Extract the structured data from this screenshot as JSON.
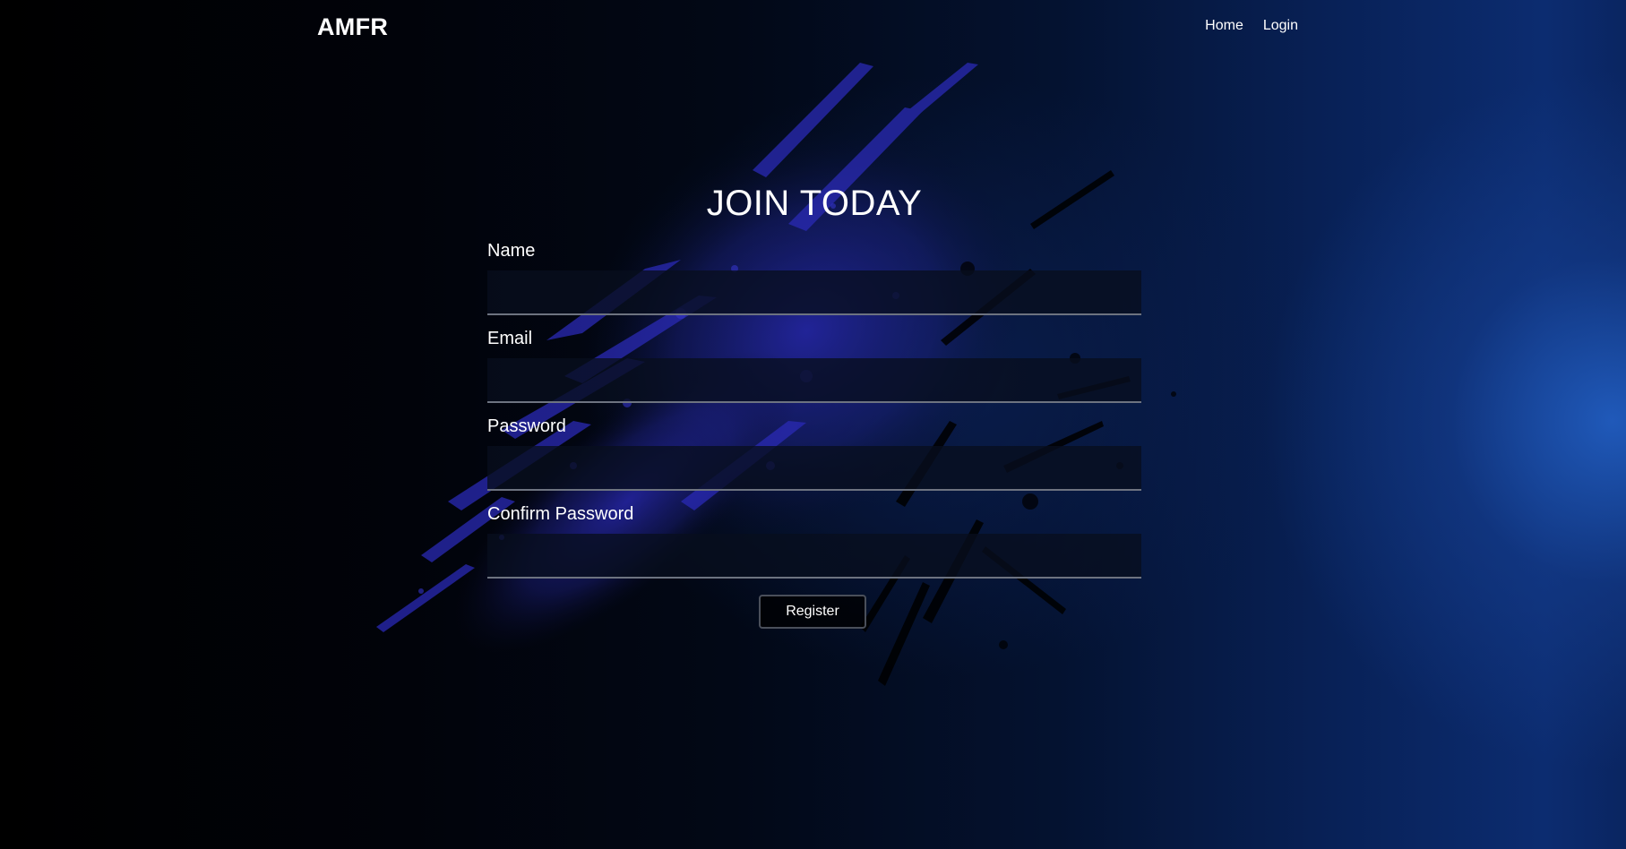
{
  "navbar": {
    "brand": "AMFR",
    "links": [
      {
        "label": "Home"
      },
      {
        "label": "Login"
      }
    ]
  },
  "form": {
    "title": "JOIN TODAY",
    "fields": [
      {
        "label": "Name",
        "value": "",
        "placeholder": ""
      },
      {
        "label": "Email",
        "value": "",
        "placeholder": ""
      },
      {
        "label": "Password",
        "value": "",
        "placeholder": ""
      },
      {
        "label": "Confirm Password",
        "value": "",
        "placeholder": ""
      }
    ],
    "submit_label": "Register"
  },
  "colors": {
    "background": "#000000",
    "accent_blue": "#215cbe",
    "splatter": "#2a2ab5",
    "text": "#ffffff",
    "field_bg": "#080e1e",
    "field_border": "#6d7380"
  }
}
